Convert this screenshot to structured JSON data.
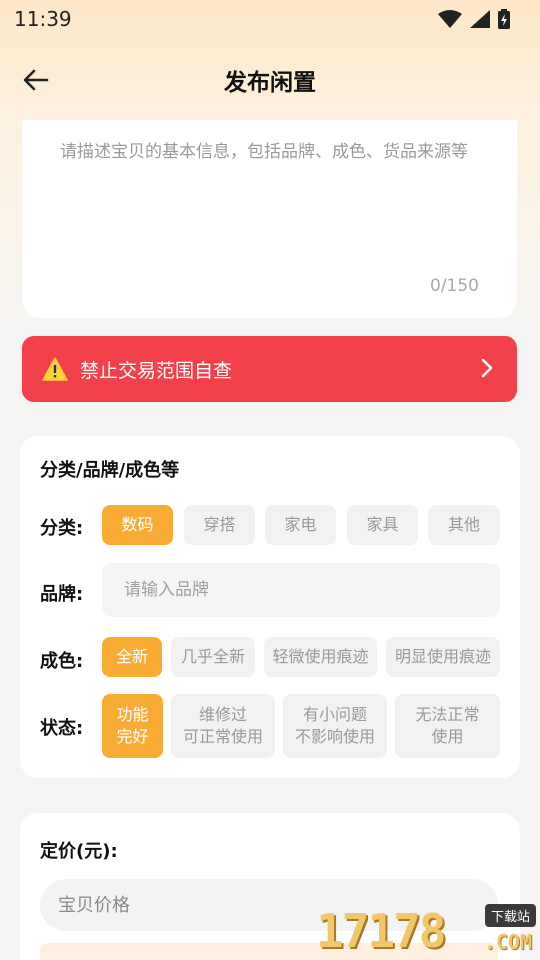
{
  "status_bar": {
    "time": "11:39"
  },
  "header": {
    "title": "发布闲置"
  },
  "description": {
    "placeholder": "请描述宝贝的基本信息，包括品牌、成色、货品来源等",
    "counter": "0/150"
  },
  "warning_banner": {
    "label": "禁止交易范围自查",
    "color": "#f2414a"
  },
  "category_section": {
    "title": "分类/品牌/成色等",
    "category": {
      "label": "分类:",
      "options": [
        "数码",
        "穿搭",
        "家电",
        "家具",
        "其他"
      ],
      "selected": "数码"
    },
    "brand": {
      "label": "品牌:",
      "placeholder": "请输入品牌"
    },
    "condition": {
      "label": "成色:",
      "options": [
        "全新",
        "几乎全新",
        "轻微使用痕迹",
        "明显使用痕迹"
      ],
      "selected": "全新"
    },
    "state": {
      "label": "状态:",
      "options": [
        {
          "line1": "功能",
          "line2": "完好"
        },
        {
          "line1": "维修过",
          "line2": "可正常使用"
        },
        {
          "line1": "有小问题",
          "line2": "不影响使用"
        },
        {
          "line1": "无法正常",
          "line2": "使用"
        }
      ],
      "selected_index": 0
    }
  },
  "price_section": {
    "title": "定价(元):",
    "placeholder": "宝贝价格"
  },
  "watermark": {
    "number": "17178",
    "badge": "下载站",
    "suffix": ".COM"
  },
  "colors": {
    "accent": "#f9ac35",
    "warning": "#f2414a"
  }
}
